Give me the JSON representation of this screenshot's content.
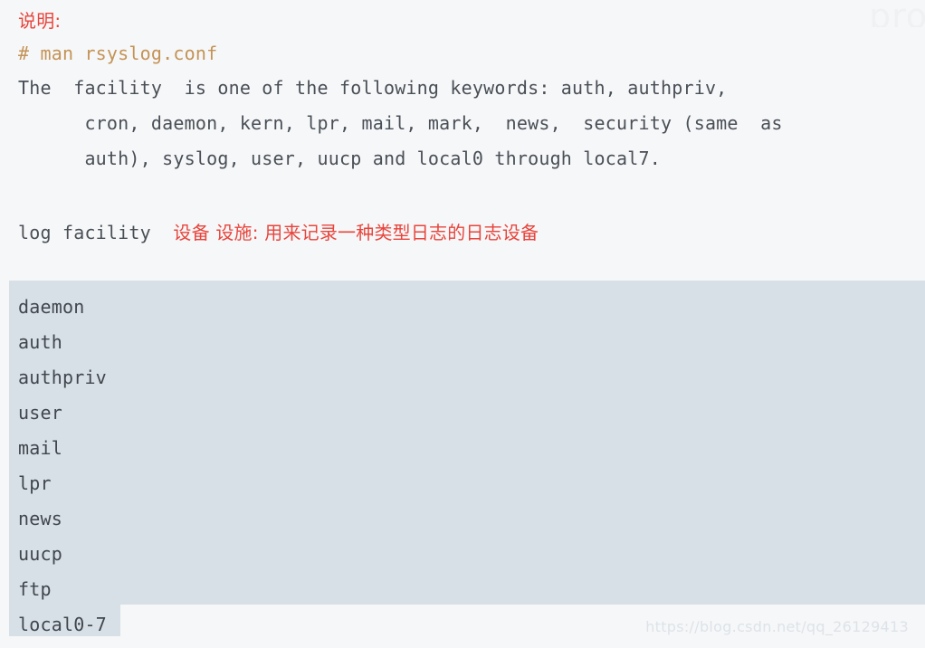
{
  "document": {
    "heading": "说明:",
    "command": "# man rsyslog.conf",
    "man_text": [
      "The  facility  is one of the following keywords: auth, authpriv,",
      "      cron, daemon, kern, lpr, mail, mark,  news,  security (same  as",
      "      auth), syslog, user, uucp and local0 through local7."
    ],
    "facility_label": "log facility",
    "facility_note_cn": "设备 设施: 用来记录一种类型日志的日志设备"
  },
  "code_block": {
    "lines": [
      "daemon",
      "auth",
      "authpriv",
      "user",
      "mail",
      "lpr",
      "news",
      "uucp",
      "ftp",
      "local0-7"
    ]
  },
  "watermarks": {
    "bottom": "https://blog.csdn.net/qq_26129413",
    "top_partial": "pro"
  },
  "colors": {
    "page_background": "#f6f7f8",
    "code_background": "#d7e0e6",
    "body_text": "#4a4f57",
    "command_text": "#c49356",
    "accent_red": "#e8453c",
    "watermark": "#dde3e9"
  }
}
